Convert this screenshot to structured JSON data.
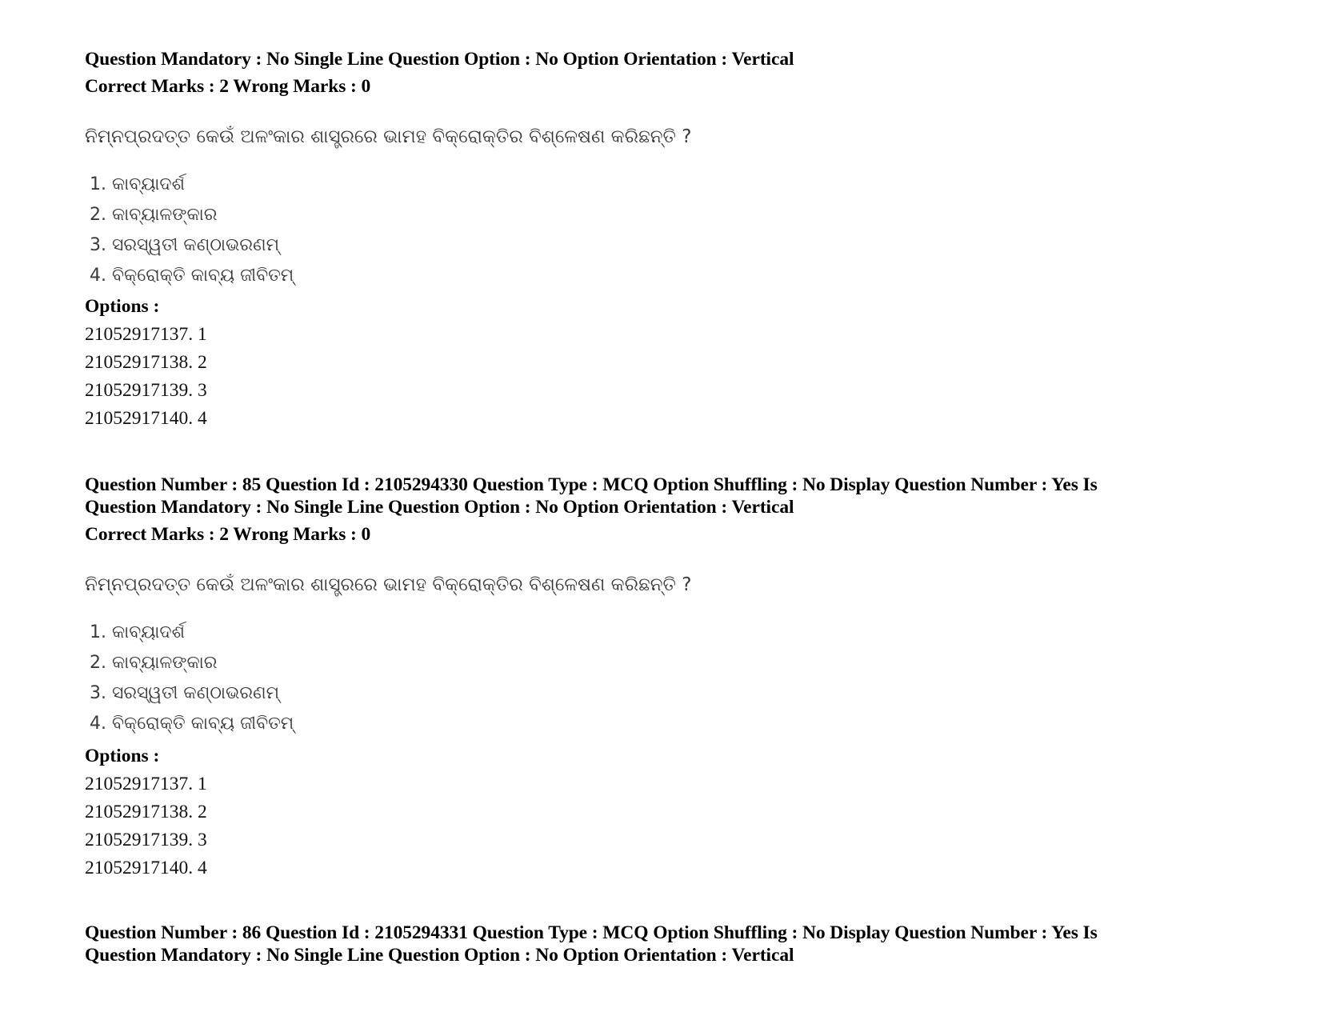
{
  "blocks": [
    {
      "header_lines": [
        "Question Mandatory : No Single Line Question Option : No Option Orientation : Vertical"
      ],
      "marks": "Correct Marks : 2 Wrong Marks : 0",
      "question": "ନିମ୍ନପ୍ରଦତ୍ତ କେଉଁ ଅଳଂକାର ଶାସ୍ତ୍ରରେ ଭାମହ ବିକ୍ରୋକ୍ତିର ବିଶ୍ଳେଷଣ କରିଛନ୍ତି ?",
      "list_items": [
        "1. କାବ୍ୟାଦର୍ଶ",
        "2. କାବ୍ୟାଳଙ୍କାର",
        "3. ସରସ୍ୱତୀ କଣ୍ଠାଭରଣମ୍",
        "4. ବିକ୍ରୋକ୍ତି କାବ୍ୟ ଜୀବିତମ୍"
      ],
      "options_label": "Options :",
      "options": [
        "21052917137. 1",
        "21052917138. 2",
        "21052917139. 3",
        "21052917140. 4"
      ]
    },
    {
      "header_lines": [
        "Question Number : 85 Question Id : 2105294330 Question Type : MCQ Option Shuffling : No Display Question Number : Yes Is",
        "Question Mandatory : No Single Line Question Option : No Option Orientation : Vertical"
      ],
      "marks": "Correct Marks : 2 Wrong Marks : 0",
      "question": "ନିମ୍ନପ୍ରଦତ୍ତ କେଉଁ ଅଳଂକାର ଶାସ୍ତ୍ରରେ ଭାମହ ବିକ୍ରୋକ୍ତିର ବିଶ୍ଳେଷଣ କରିଛନ୍ତି ?",
      "list_items": [
        "1. କାବ୍ୟାଦର୍ଶ",
        "2. କାବ୍ୟାଳଙ୍କାର",
        "3. ସରସ୍ୱତୀ କଣ୍ଠାଭରଣମ୍",
        "4. ବିକ୍ରୋକ୍ତି କାବ୍ୟ ଜୀବିତମ୍"
      ],
      "options_label": "Options :",
      "options": [
        "21052917137. 1",
        "21052917138. 2",
        "21052917139. 3",
        "21052917140. 4"
      ]
    },
    {
      "header_lines": [
        "Question Number : 86 Question Id : 2105294331 Question Type : MCQ Option Shuffling : No Display Question Number : Yes Is",
        "Question Mandatory : No Single Line Question Option : No Option Orientation : Vertical"
      ]
    }
  ]
}
